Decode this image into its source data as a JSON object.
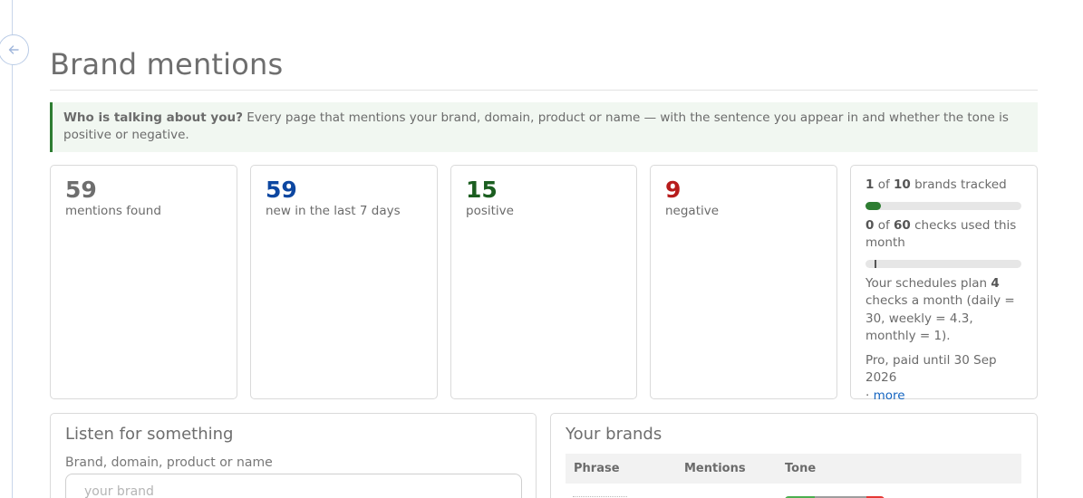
{
  "header": {
    "title": "Brand mentions"
  },
  "intro": {
    "lead": "Who is talking about you?",
    "text": " Every page that mentions your brand, domain, product or name — with the sentence you appear in and whether the tone is positive or negative."
  },
  "stats": [
    {
      "value": "59",
      "label": "mentions found",
      "color": "#6e6e6e"
    },
    {
      "value": "59",
      "label": "new in the last 7 days",
      "color": "#0d47a1"
    },
    {
      "value": "15",
      "label": "positive",
      "color": "#1b5e20"
    },
    {
      "value": "9",
      "label": "negative",
      "color": "#b71c1c"
    }
  ],
  "usage": {
    "brands_used": "1",
    "brands_of": " of ",
    "brands_total": "10",
    "brands_suffix": " brands tracked",
    "brands_fraction": 0.1,
    "checks_used": "0",
    "checks_of": " of ",
    "checks_total": "60",
    "checks_suffix": " checks used this month",
    "checks_fraction": 0,
    "schedule_prefix": "Your schedules plan ",
    "schedule_count": "4",
    "schedule_suffix": " checks a month (daily = 30, weekly = 4.3, monthly = 1).",
    "plan_text": "Pro, paid until 30 Sep 2026",
    "more_sep": "· ",
    "more_label": "more"
  },
  "listen": {
    "title": "Listen for something",
    "field_label": "Brand, domain, product or name",
    "placeholder": "your brand"
  },
  "brands": {
    "title": "Your brands",
    "columns": [
      "Phrase",
      "Mentions",
      "Tone"
    ],
    "tone_colors": {
      "positive": "#4caf50",
      "neutral": "#9e9e9e",
      "negative": "#e53935"
    }
  }
}
